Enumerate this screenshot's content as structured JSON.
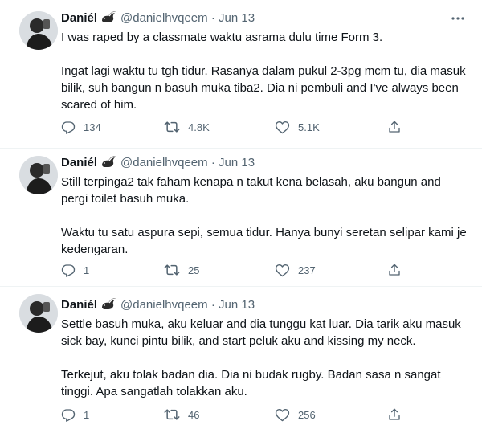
{
  "tweets": [
    {
      "author_name": "Daniél",
      "handle": "@danielhvqeem",
      "separator": "·",
      "date": "Jun 13",
      "paragraphs": [
        "I was raped by a classmate waktu asrama dulu time Form 3.",
        "Ingat lagi waktu tu tgh tidur. Rasanya dalam pukul 2-3pg mcm tu, dia masuk bilik, suh bangun n basuh muka tiba2. Dia ni pembuli and I've always been scared of him."
      ],
      "replies": "134",
      "retweets": "4.8K",
      "likes": "5.1K"
    },
    {
      "author_name": "Daniél",
      "handle": "@danielhvqeem",
      "separator": "·",
      "date": "Jun 13",
      "paragraphs": [
        "Still terpinga2 tak faham kenapa n takut kena belasah, aku bangun and pergi toilet basuh muka.",
        "Waktu tu satu aspura sepi, semua tidur. Hanya bunyi seretan selipar kami je kedengaran."
      ],
      "replies": "1",
      "retweets": "25",
      "likes": "237"
    },
    {
      "author_name": "Daniél",
      "handle": "@danielhvqeem",
      "separator": "·",
      "date": "Jun 13",
      "paragraphs": [
        "Settle basuh muka, aku keluar and dia tunggu kat luar. Dia tarik aku masuk sick bay, kunci pintu bilik, and start peluk aku and kissing my neck.",
        "Terkejut, aku tolak badan dia. Dia ni budak rugby. Badan sasa n sangat tinggi. Apa sangatlah tolakkan aku."
      ],
      "replies": "1",
      "retweets": "46",
      "likes": "256"
    }
  ],
  "icons": {
    "author_emoji": "skunk-emoji-icon",
    "more": "more-options-icon",
    "reply": "reply-icon",
    "retweet": "retweet-icon",
    "like": "like-icon",
    "share": "share-icon"
  },
  "colors": {
    "text": "#0f1419",
    "secondary": "#536471",
    "divider": "#eff3f4",
    "background": "#ffffff"
  }
}
